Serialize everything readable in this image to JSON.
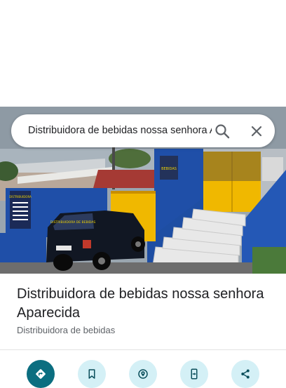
{
  "search": {
    "query": "Distribuidora de bebidas nossa senhora Aparecida",
    "search_icon": "search-icon",
    "close_icon": "close-icon"
  },
  "photo": {
    "banner_left_text": "DISTRIBUIDORA",
    "car_windshield_text": "DISTRIBUIDORA DE BEBIDAS"
  },
  "place": {
    "title": "Distribuidora de bebidas nossa senhora Aparecida",
    "category": "Distribuidora de bebidas"
  },
  "actions": [
    {
      "icon": "directions-icon",
      "style": "primary"
    },
    {
      "icon": "bookmark-icon",
      "style": "secondary"
    },
    {
      "icon": "nearby-icon",
      "style": "secondary"
    },
    {
      "icon": "send-to-phone-icon",
      "style": "secondary"
    },
    {
      "icon": "share-icon",
      "style": "secondary"
    }
  ],
  "colors": {
    "accent": "#0b6e80",
    "accent_light": "#d4f0f6",
    "building_blue": "#1f4fa8",
    "building_yellow": "#f0b800"
  }
}
